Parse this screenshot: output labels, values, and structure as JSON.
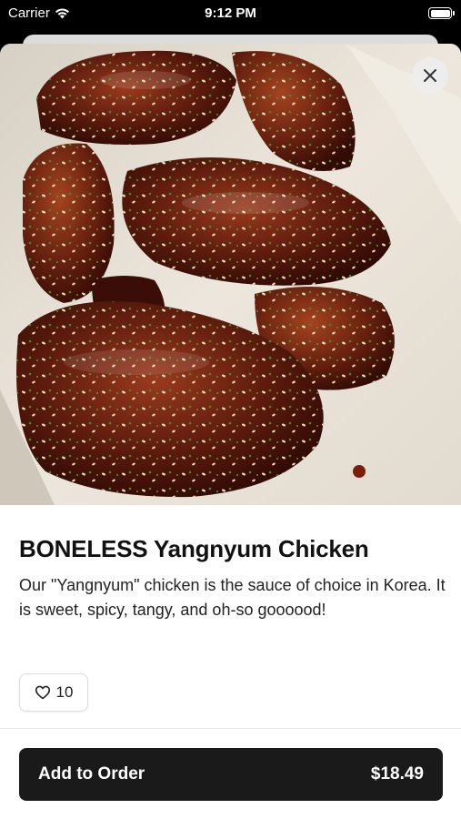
{
  "status_bar": {
    "carrier": "Carrier",
    "time": "9:12 PM",
    "icons": [
      "wifi-icon",
      "battery-icon"
    ]
  },
  "item": {
    "image_alt": "",
    "title": "BONELESS Yangnyum Chicken",
    "description": "Our \"Yangnyum\" chicken is the sauce of choice in Korea.  It is sweet, spicy, tangy, and oh-so goooood!",
    "like_count": "10"
  },
  "actions": {
    "add_label": "Add to Order",
    "price": "$18.49"
  },
  "colors": {
    "button_bg": "#1a1a1a",
    "sauce": "#5a1a0c",
    "paper": "#e8e1d6"
  }
}
